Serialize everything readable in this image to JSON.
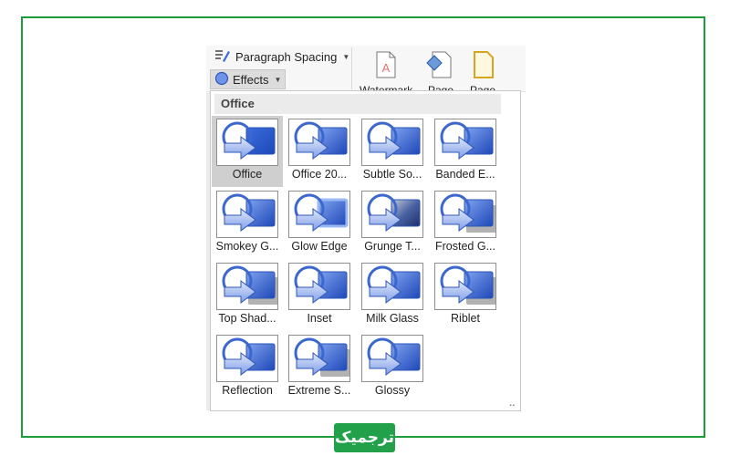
{
  "ribbon": {
    "paragraph_spacing_label": "Paragraph Spacing",
    "effects_label": "Effects",
    "watermark_label": "Watermark",
    "page_color_label": "Page",
    "page_borders_label": "Page"
  },
  "gallery": {
    "header": "Office",
    "items": [
      {
        "label": "Office",
        "selected": true
      },
      {
        "label": "Office 20...",
        "selected": false
      },
      {
        "label": "Subtle So...",
        "selected": false
      },
      {
        "label": "Banded E...",
        "selected": false
      },
      {
        "label": "Smokey G...",
        "selected": false
      },
      {
        "label": "Glow Edge",
        "selected": false
      },
      {
        "label": "Grunge T...",
        "selected": false
      },
      {
        "label": "Frosted G...",
        "selected": false
      },
      {
        "label": "Top Shad...",
        "selected": false
      },
      {
        "label": "Inset",
        "selected": false
      },
      {
        "label": "Milk Glass",
        "selected": false
      },
      {
        "label": "Riblet",
        "selected": false
      },
      {
        "label": "Reflection",
        "selected": false
      },
      {
        "label": "Extreme S...",
        "selected": false
      },
      {
        "label": "Glossy",
        "selected": false
      }
    ]
  },
  "logo_text": "ترجمیک",
  "colors": {
    "frame": "#1e9c3c",
    "accent_blue": "#2f5fd0",
    "logo_bg": "#22a14a"
  }
}
